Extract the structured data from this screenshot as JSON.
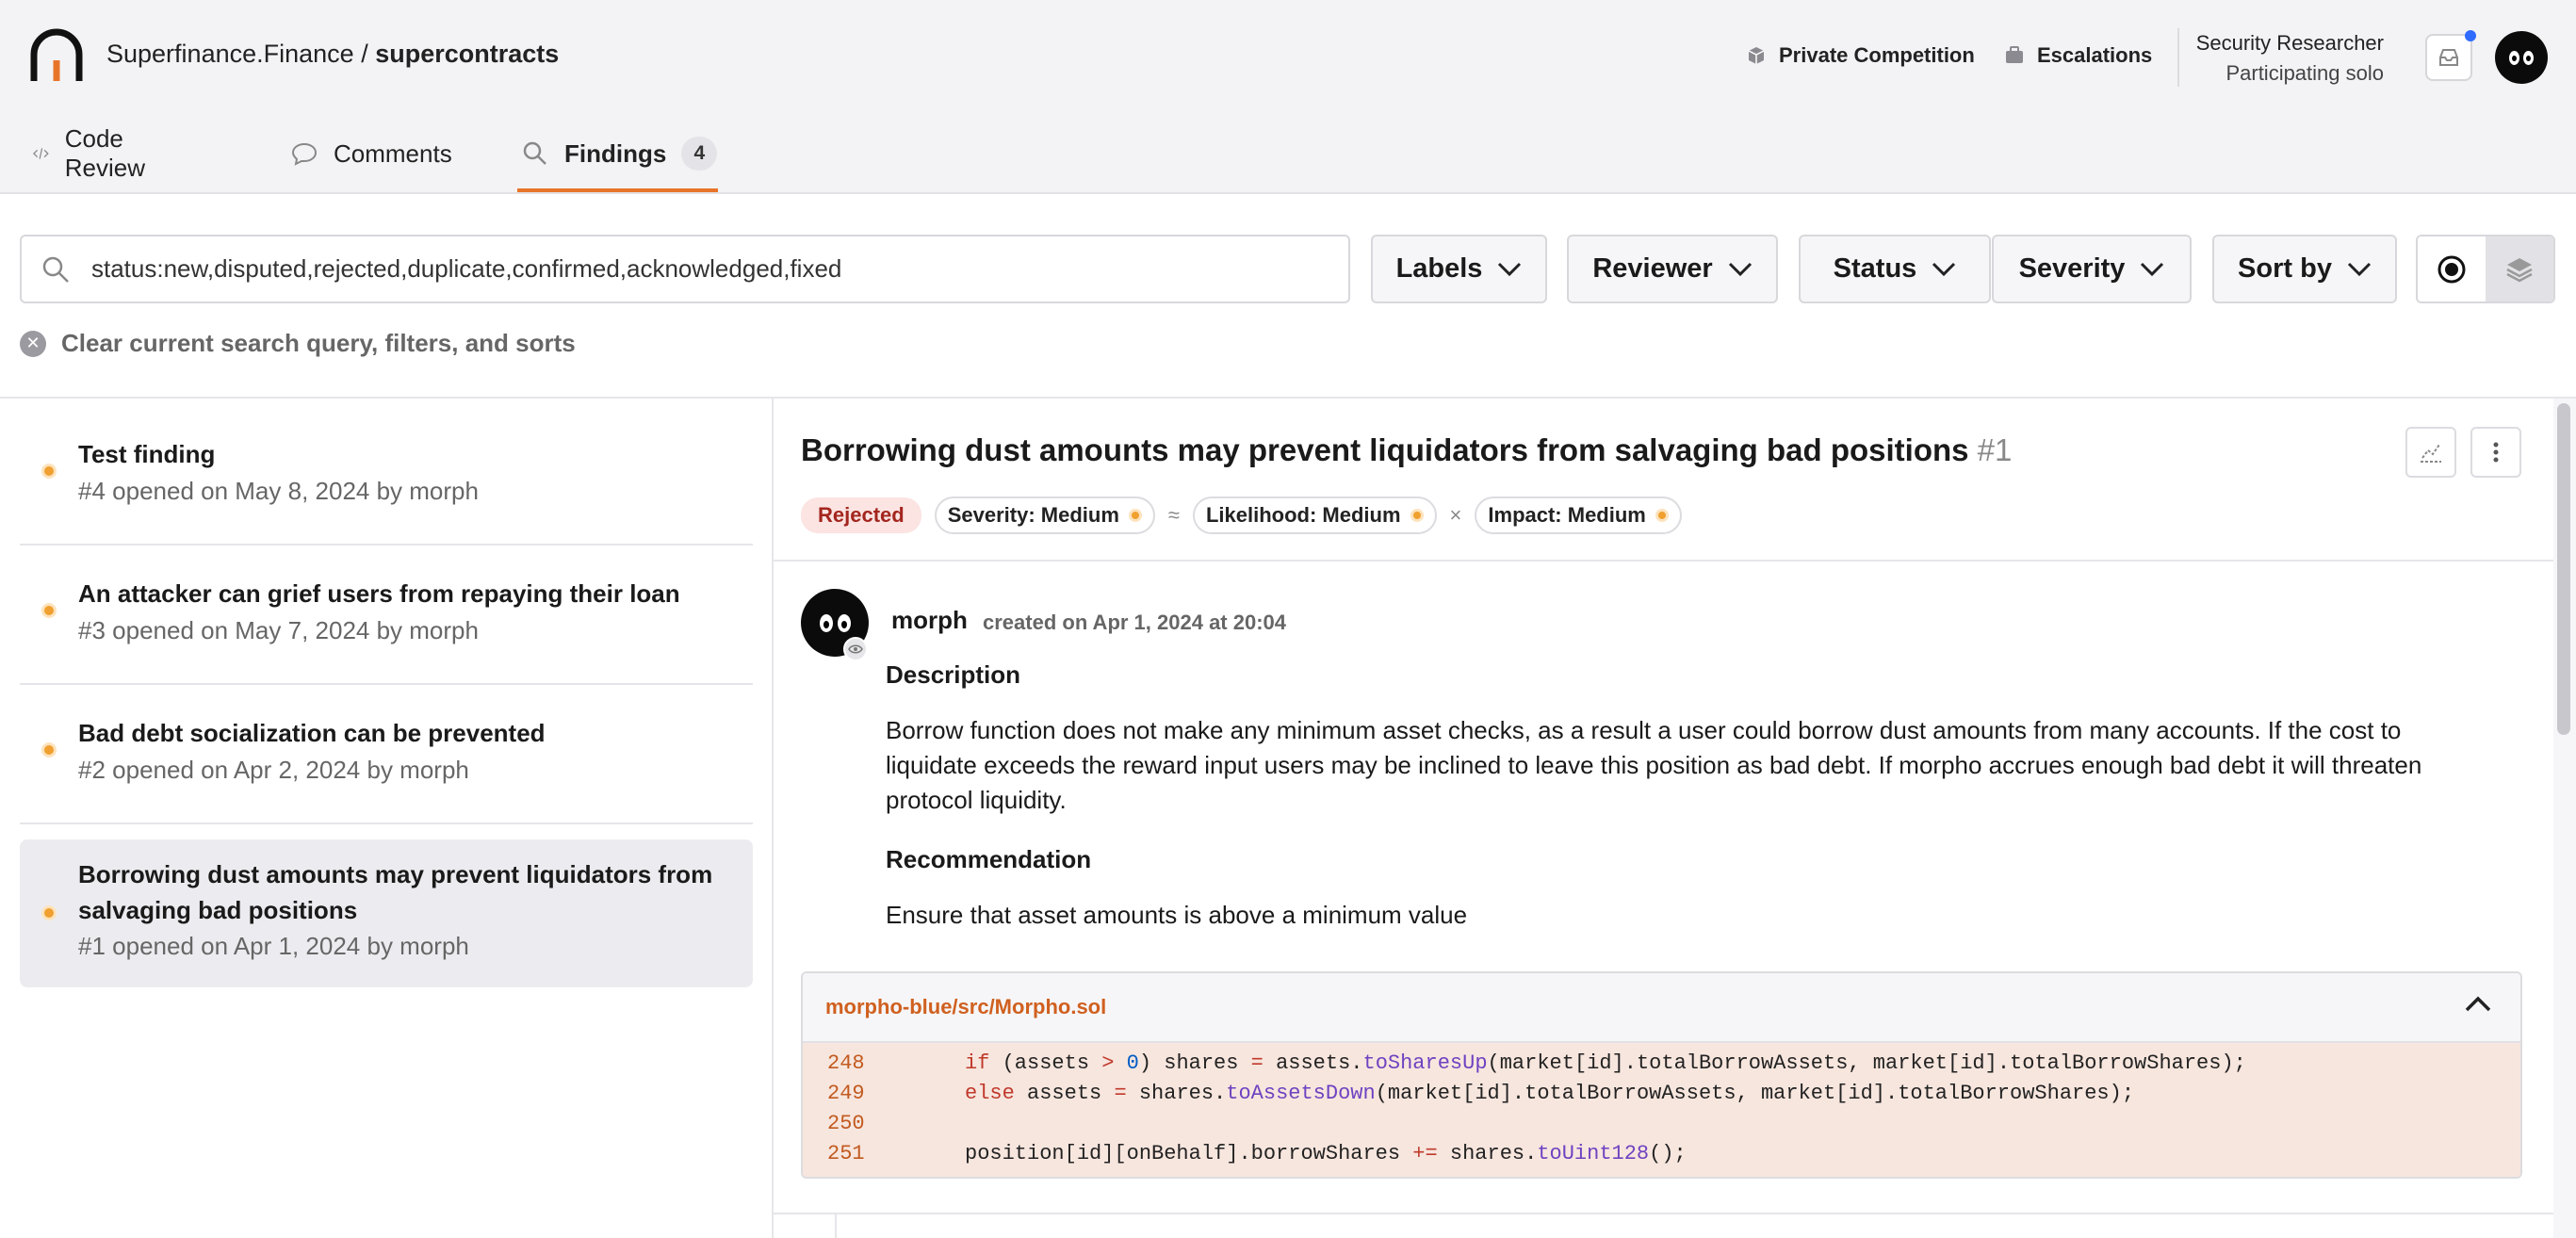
{
  "header": {
    "org": "Superfinance.Finance",
    "separator": "/",
    "repo": "supercontracts",
    "private_competition": "Private Competition",
    "escalations": "Escalations",
    "role_title": "Security Researcher",
    "role_subtitle": "Participating solo"
  },
  "tabs": [
    {
      "label": "Code Review",
      "icon": "code-icon"
    },
    {
      "label": "Comments",
      "icon": "comment-icon"
    },
    {
      "label": "Findings",
      "icon": "search-icon",
      "count": "4",
      "active": true
    }
  ],
  "filters": {
    "search_value": "status:new,disputed,rejected,duplicate,confirmed,acknowledged,fixed",
    "labels": "Labels",
    "reviewer": "Reviewer",
    "status": "Status",
    "severity": "Severity",
    "sort_by": "Sort by",
    "clear_text": "Clear current search query, filters, and sorts"
  },
  "findings": [
    {
      "title": "Test finding",
      "meta": "#4 opened on May 8, 2024 by morph"
    },
    {
      "title": "An attacker can grief users from repaying their loan",
      "meta": "#3 opened on May 7, 2024 by morph"
    },
    {
      "title": "Bad debt socialization can be prevented",
      "meta": "#2 opened on Apr 2, 2024 by morph"
    },
    {
      "title": "Borrowing dust amounts may prevent liquidators from salvaging bad positions",
      "meta": "#1 opened on Apr 1, 2024 by morph",
      "selected": true
    }
  ],
  "detail": {
    "title": "Borrowing dust amounts may prevent liquidators from salvaging bad positions",
    "number": "#1",
    "status": "Rejected",
    "severity": "Severity: Medium",
    "approx": "≈",
    "likelihood": "Likelihood: Medium",
    "times": "×",
    "impact": "Impact: Medium",
    "author": "morph",
    "created": "created on Apr 1, 2024 at 20:04",
    "description_heading": "Description",
    "description": "Borrow function does not make any minimum asset checks, as a result a user could borrow dust amounts from many accounts. If the cost to liquidate exceeds the reward input users may be inclined to leave this position as bad debt. If morpho accrues enough bad debt it will threaten protocol liquidity.",
    "recommendation_heading": "Recommendation",
    "recommendation": "Ensure that asset amounts is above a minimum value",
    "code_file": "morpho-blue/src/Morpho.sol",
    "code_lines": [
      {
        "n": "248",
        "text": "if (assets > 0) shares = assets.toSharesUp(market[id].totalBorrowAssets, market[id].totalBorrowShares);"
      },
      {
        "n": "249",
        "text": "else assets = shares.toAssetsDown(market[id].totalBorrowAssets, market[id].totalBorrowShares);"
      },
      {
        "n": "250",
        "text": ""
      },
      {
        "n": "251",
        "text": "position[id][onBehalf].borrowShares += shares.toUint128();"
      }
    ]
  },
  "colors": {
    "accent": "#e8742a",
    "status_dot": "#f0a030",
    "rejected_bg": "#fbe4e2",
    "rejected_text": "#a3261e",
    "code_bg": "#f7e6de"
  }
}
